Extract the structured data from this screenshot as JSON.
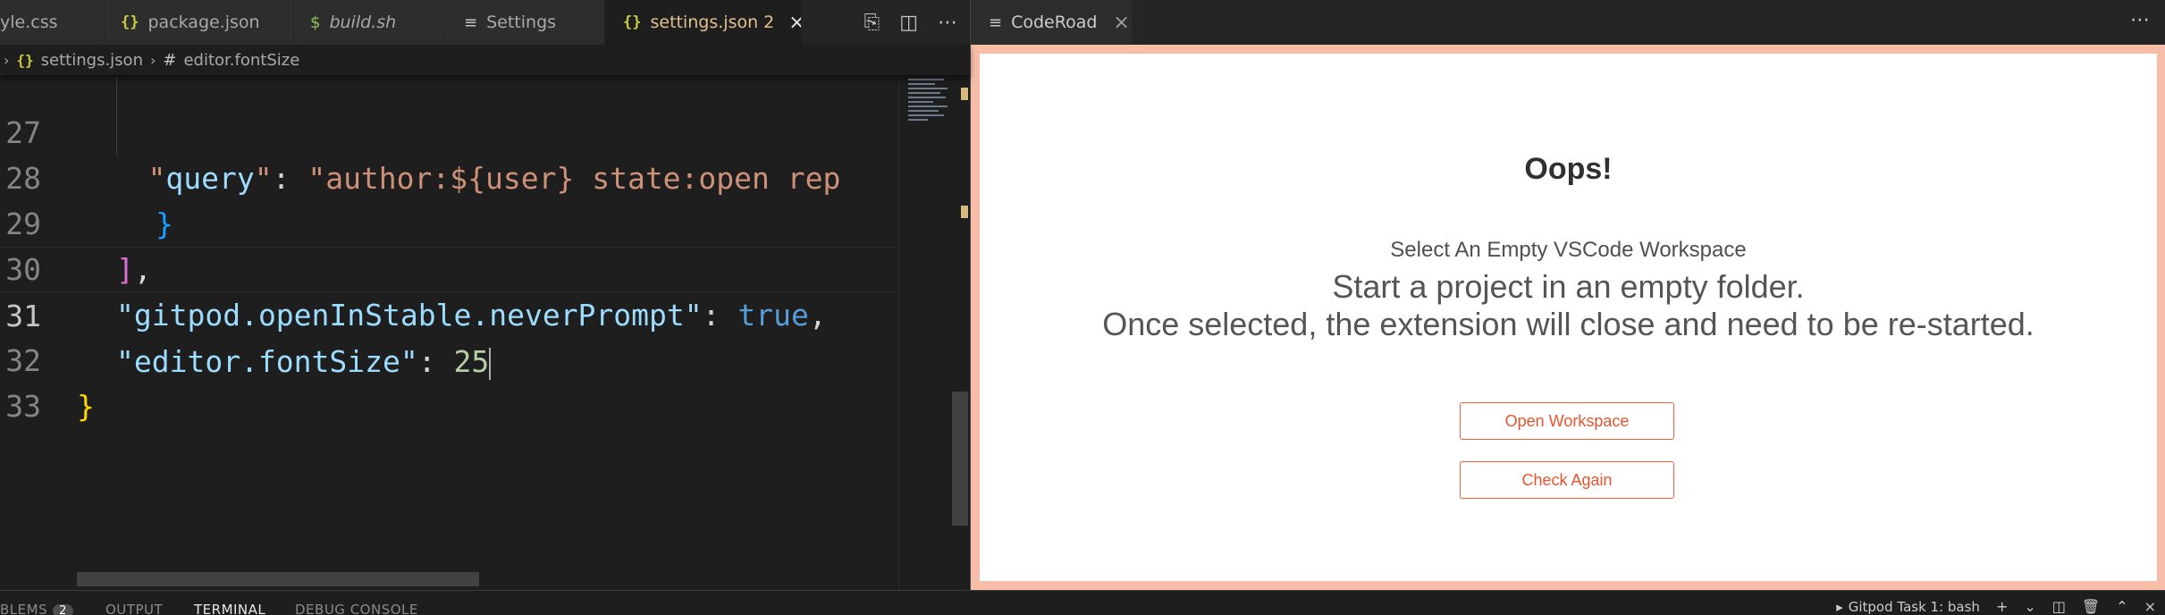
{
  "left_tabs": [
    {
      "icon": "css-file-icon",
      "label": "yle.css"
    },
    {
      "icon": "json-file-icon",
      "icon_glyph": "{}",
      "label": "package.json"
    },
    {
      "icon": "shell-file-icon",
      "icon_glyph": "$",
      "label": "build.sh"
    },
    {
      "icon": "settings-icon",
      "icon_glyph": "≡",
      "label": "Settings"
    },
    {
      "icon": "json-file-icon",
      "icon_glyph": "{}",
      "label": "settings.json 2",
      "active": true
    }
  ],
  "left_actions": [
    "open-changes-icon",
    "split-editor-icon",
    "more-actions-icon"
  ],
  "breadcrumb": {
    "file": "settings.json",
    "symbol": "editor.fontSize"
  },
  "code": {
    "lines": [
      {
        "num": "27",
        "text": "      \"query\": \"author:${user} state:open rep"
      },
      {
        "num": "28",
        "text": "    }"
      },
      {
        "num": "29",
        "text": "  ],"
      },
      {
        "num": "30",
        "key": "\"gitpod.openInStable.neverPrompt\"",
        "value": "true"
      },
      {
        "num": "31",
        "key": "\"editor.fontSize\"",
        "value": "25"
      },
      {
        "num": "32",
        "text": "}"
      },
      {
        "num": "33",
        "text": ""
      }
    ],
    "current_line": "31"
  },
  "right_tab": {
    "icon": "preview-icon",
    "label": "CodeRoad"
  },
  "webview": {
    "title": "Oops!",
    "subtitle": "Select An Empty VSCode Workspace",
    "line1": "Start a project in an empty folder.",
    "line2": "Once selected, the extension will close and need to be re-started.",
    "open_button": "Open Workspace",
    "check_button": "Check Again",
    "accent": "#f0603e",
    "frame_color": "#f7bda9"
  },
  "panel": {
    "problems": "BLEMS",
    "problems_count": "2",
    "output": "OUTPUT",
    "terminal": "TERMINAL",
    "debug": "DEBUG CONSOLE",
    "terminal_name": "Gitpod Task 1: bash"
  }
}
